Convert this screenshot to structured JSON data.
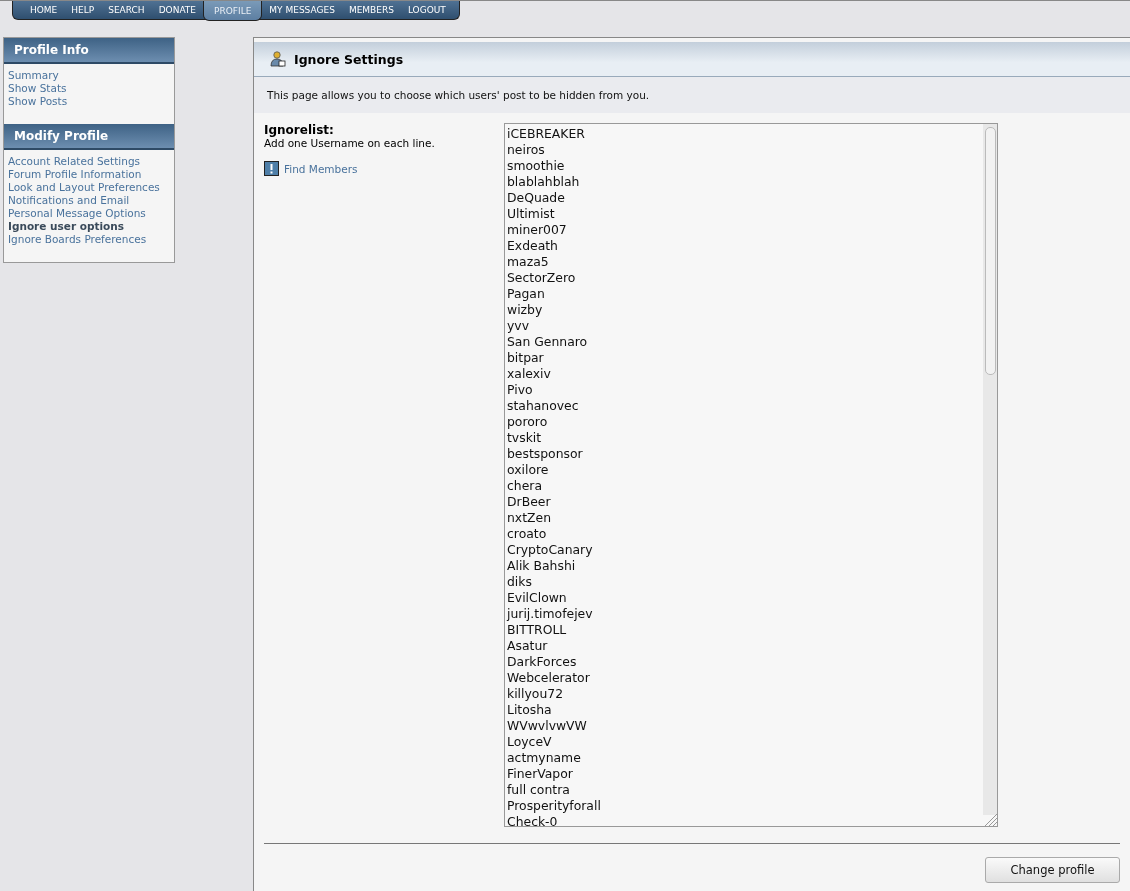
{
  "nav": [
    {
      "label": "HOME",
      "selected": false
    },
    {
      "label": "HELP",
      "selected": false
    },
    {
      "label": "SEARCH",
      "selected": false
    },
    {
      "label": "DONATE",
      "selected": false
    },
    {
      "label": "PROFILE",
      "selected": true
    },
    {
      "label": "MY MESSAGES",
      "selected": false
    },
    {
      "label": "MEMBERS",
      "selected": false
    },
    {
      "label": "LOGOUT",
      "selected": false
    }
  ],
  "sidebar": [
    {
      "title": "Profile Info",
      "items": [
        {
          "label": "Summary",
          "selected": false
        },
        {
          "label": "Show Stats",
          "selected": false
        },
        {
          "label": "Show Posts",
          "selected": false
        }
      ]
    },
    {
      "title": "Modify Profile",
      "items": [
        {
          "label": "Account Related Settings",
          "selected": false
        },
        {
          "label": "Forum Profile Information",
          "selected": false
        },
        {
          "label": "Look and Layout Preferences",
          "selected": false
        },
        {
          "label": "Notifications and Email",
          "selected": false
        },
        {
          "label": "Personal Message Options",
          "selected": false
        },
        {
          "label": "Ignore user options",
          "selected": true
        },
        {
          "label": "Ignore Boards Preferences",
          "selected": false
        }
      ]
    }
  ],
  "panel": {
    "title": "Ignore Settings",
    "description": "This page allows you to choose which users' post to be hidden from you.",
    "field_label": "Ignorelist:",
    "field_hint": "Add one Username on each line.",
    "find_members": "Find Members",
    "ignore_list": [
      "iCEBREAKER",
      "neiros",
      "smoothie",
      "blablahblah",
      "DeQuade",
      "Ultimist",
      "miner007",
      "Exdeath",
      "maza5",
      "SectorZero",
      "Pagan",
      "wizby",
      "yvv",
      "San Gennaro",
      "bitpar",
      "xalexiv",
      "Pivo",
      "stahanovec",
      "pororo",
      "tvskit",
      "bestsponsor",
      "oxilore",
      "chera",
      "DrBeer",
      "nxtZen",
      "croato",
      "CryptoCanary",
      "Alik Bahshi",
      "diks",
      "EvilClown",
      "jurij.timofejev",
      "BITTROLL",
      "Asatur",
      "DarkForces",
      "Webcelerator",
      "killyou72",
      "Litosha",
      "WVwvlvwVW",
      "LoyceV",
      "actmyname",
      "FinerVapor",
      "full contra",
      "Prosperityforall",
      "Check-0"
    ],
    "submit": "Change profile"
  }
}
